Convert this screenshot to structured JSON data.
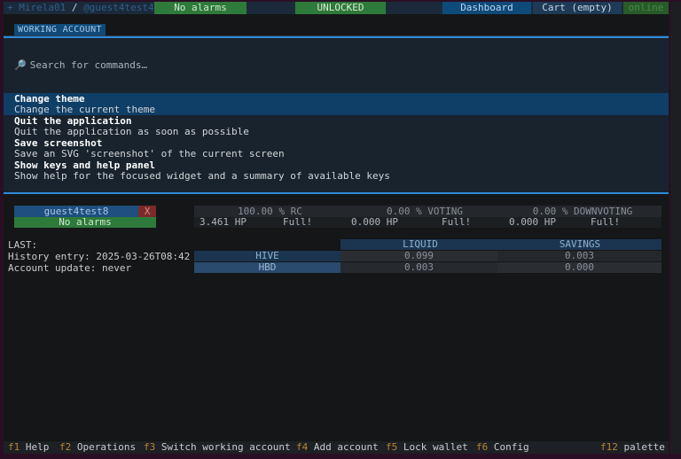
{
  "header": {
    "profile_prefix": "+ ",
    "profile_name": "Mirela01",
    "separator": " / ",
    "working_account": "@guest4test4",
    "alarms": "No alarms",
    "lock_status": "UNLOCKED",
    "dashboard": "Dashboard",
    "cart": "Cart (empty)",
    "online": "online"
  },
  "tab": {
    "label": "WORKING ACCOUNT"
  },
  "palette": {
    "search_placeholder": "Search for commands…",
    "search_icon": "magnifier-icon",
    "commands": [
      {
        "title": "Change theme",
        "desc": "Change the current theme"
      },
      {
        "title": "Quit the application",
        "desc": "Quit the application as soon as possible"
      },
      {
        "title": "Save screenshot",
        "desc": "Save an SVG 'screenshot' of the current screen"
      },
      {
        "title": "Show keys and help panel",
        "desc": "Show help for the focused widget and a summary of available keys"
      }
    ]
  },
  "account": {
    "name": "guest4test8",
    "remove": "X",
    "alarms": "No alarms"
  },
  "manabars": {
    "rc": {
      "pct": "100.00 % RC",
      "hp": "3.461 HP",
      "status": "Full!"
    },
    "voting": {
      "pct": "0.00 % VOTING",
      "hp": "0.000 HP",
      "status": "Full!"
    },
    "downvoting": {
      "pct": "0.00 % DOWNVOTING",
      "hp": "0.000 HP",
      "status": "Full!"
    }
  },
  "info": {
    "last": "LAST:",
    "history": "History entry: 2025-03-26T08:42",
    "update": "Account update: never"
  },
  "balances": {
    "headers": {
      "liquid": "LIQUID",
      "savings": "SAVINGS"
    },
    "rows": [
      {
        "asset": "HIVE",
        "liquid": "0.099",
        "savings": "0.003"
      },
      {
        "asset": "HBD",
        "liquid": "0.003",
        "savings": "0.000"
      }
    ]
  },
  "footer": {
    "items": [
      {
        "key": "f1",
        "label": "Help"
      },
      {
        "key": "f2",
        "label": "Operations"
      },
      {
        "key": "f3",
        "label": "Switch working account"
      },
      {
        "key": "f4",
        "label": "Add account"
      },
      {
        "key": "f5",
        "label": "Lock wallet"
      },
      {
        "key": "f6",
        "label": "Config"
      },
      {
        "key": "f12",
        "label": "palette"
      }
    ]
  }
}
